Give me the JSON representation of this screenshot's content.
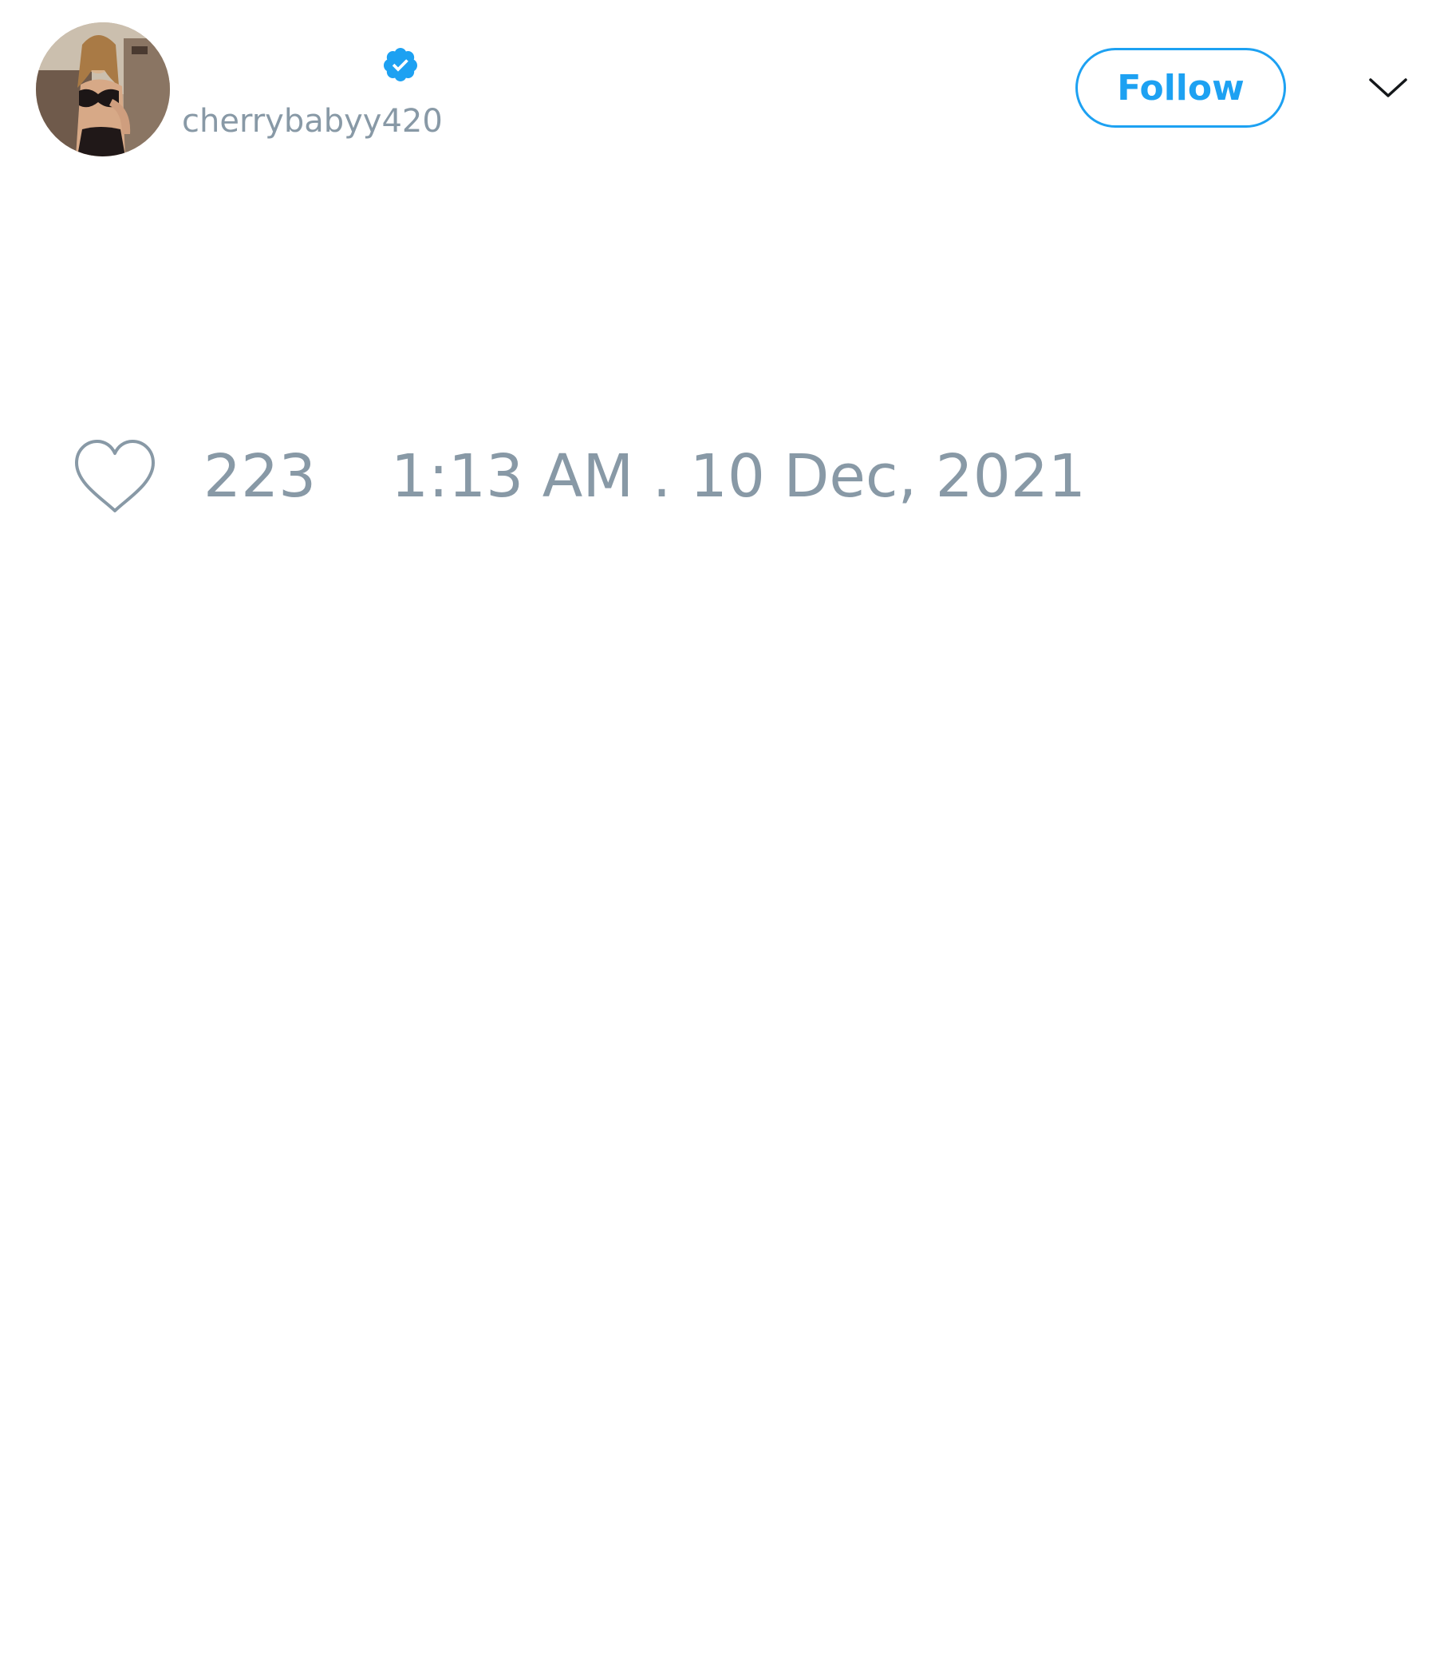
{
  "colors": {
    "accent": "#1da1f2",
    "muted_text": "#8899a6",
    "background": "#ffffff"
  },
  "tweet": {
    "author": {
      "display_name": "",
      "handle": "cherrybabyy420",
      "verified": true,
      "avatar_icon": "profile-photo"
    },
    "follow_label": "Follow",
    "menu_icon": "chevron-down-icon",
    "like_icon": "heart-outline-icon",
    "like_count": "223",
    "timestamp": "1:13 AM . 10 Dec, 2021"
  }
}
